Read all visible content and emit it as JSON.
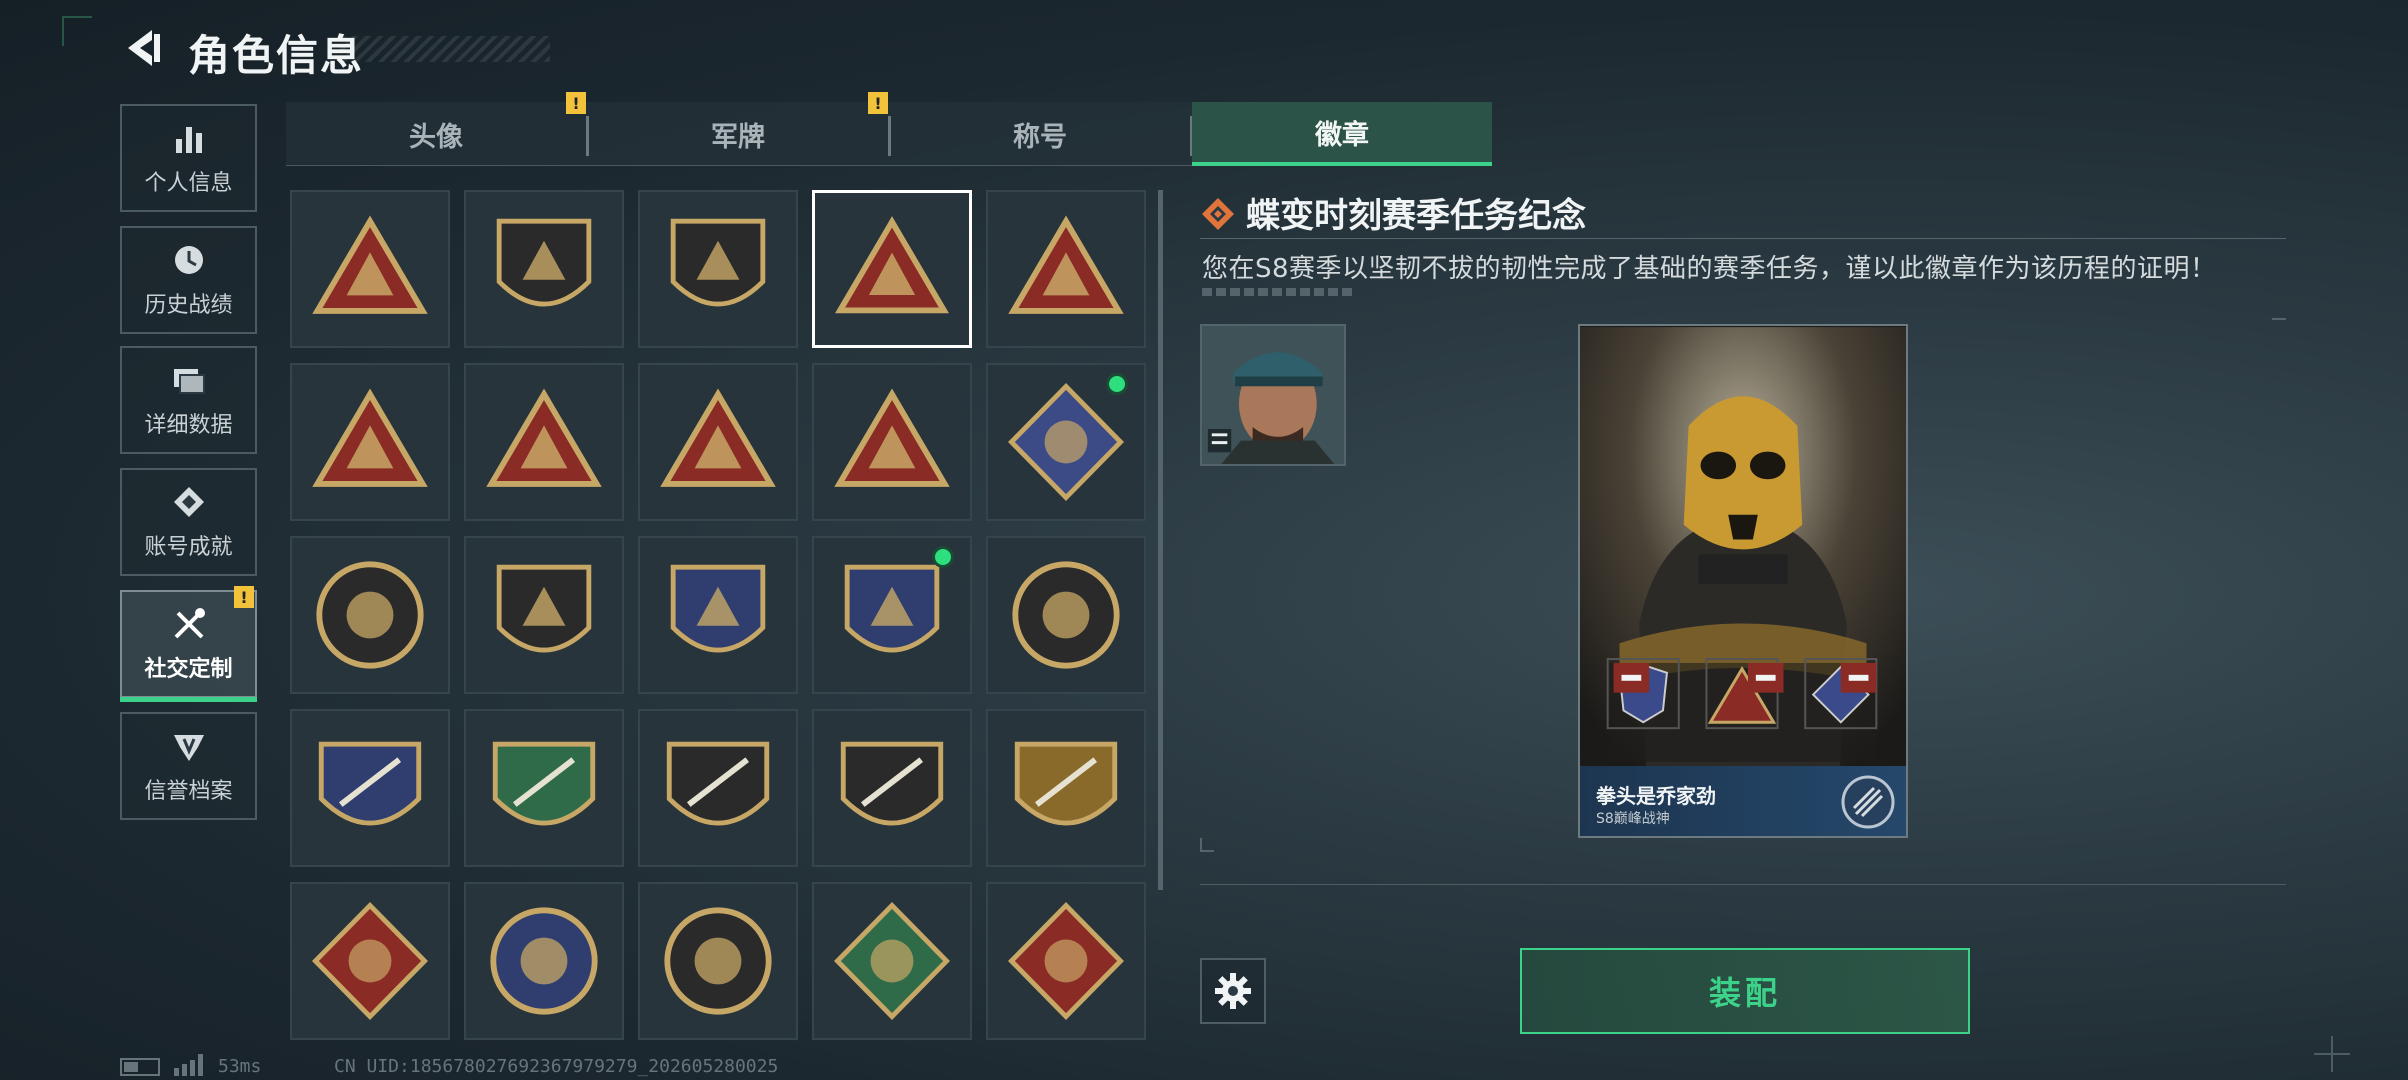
{
  "header": {
    "title": "角色信息"
  },
  "sidebar": {
    "items": [
      {
        "label": "个人信息",
        "icon": "bar-chart-icon"
      },
      {
        "label": "历史战绩",
        "icon": "clock-icon"
      },
      {
        "label": "详细数据",
        "icon": "folders-icon"
      },
      {
        "label": "账号成就",
        "icon": "achievement-icon"
      },
      {
        "label": "社交定制",
        "icon": "tools-icon",
        "active": true,
        "alert": "!"
      },
      {
        "label": "信誉档案",
        "icon": "shield-wing-icon"
      }
    ]
  },
  "tabs": [
    {
      "label": "头像",
      "alert": "!"
    },
    {
      "label": "军牌",
      "alert": "!"
    },
    {
      "label": "称号"
    },
    {
      "label": "徽章",
      "active": true
    }
  ],
  "badges": [
    [
      "badge-triangle-shield",
      "badge-helicopter",
      "badge-dagger-shield",
      "badge-s8-selected",
      "badge-s9"
    ],
    [
      "badge-hand-sign",
      "badge-number-one",
      "badge-usb-drive",
      "badge-soldiers",
      "badge-rose-new"
    ],
    [
      "badge-star-round",
      "badge-chevron-shield",
      "badge-red-crest",
      "badge-crystal-crest-new",
      "badge-skull-round"
    ],
    [
      "badge-rifle-blue",
      "badge-rifle-green",
      "badge-rifle-dark",
      "badge-rifle-brown",
      "badge-rifle-gold"
    ],
    [
      "badge-wolf",
      "badge-eagle",
      "badge-scope",
      "badge-medic",
      "badge-dragon"
    ]
  ],
  "detail": {
    "title": "蝶变时刻赛季任务纪念",
    "description": "您在S8赛季以坚韧不拔的韧性完成了基础的赛季任务，谨以此徽章作为该历程的证明！",
    "card_name": "拳头是乔家劲",
    "card_sub": "S8巅峰战神",
    "equip_label": "装配"
  },
  "status": {
    "ping": "53ms",
    "uid": "CN UID:185678027692367979279_202605280025"
  },
  "colors": {
    "accent": "#3dd28a",
    "warning": "#f2c23a",
    "badge_gold": "#c7a766",
    "badge_red": "#8b2b25"
  }
}
